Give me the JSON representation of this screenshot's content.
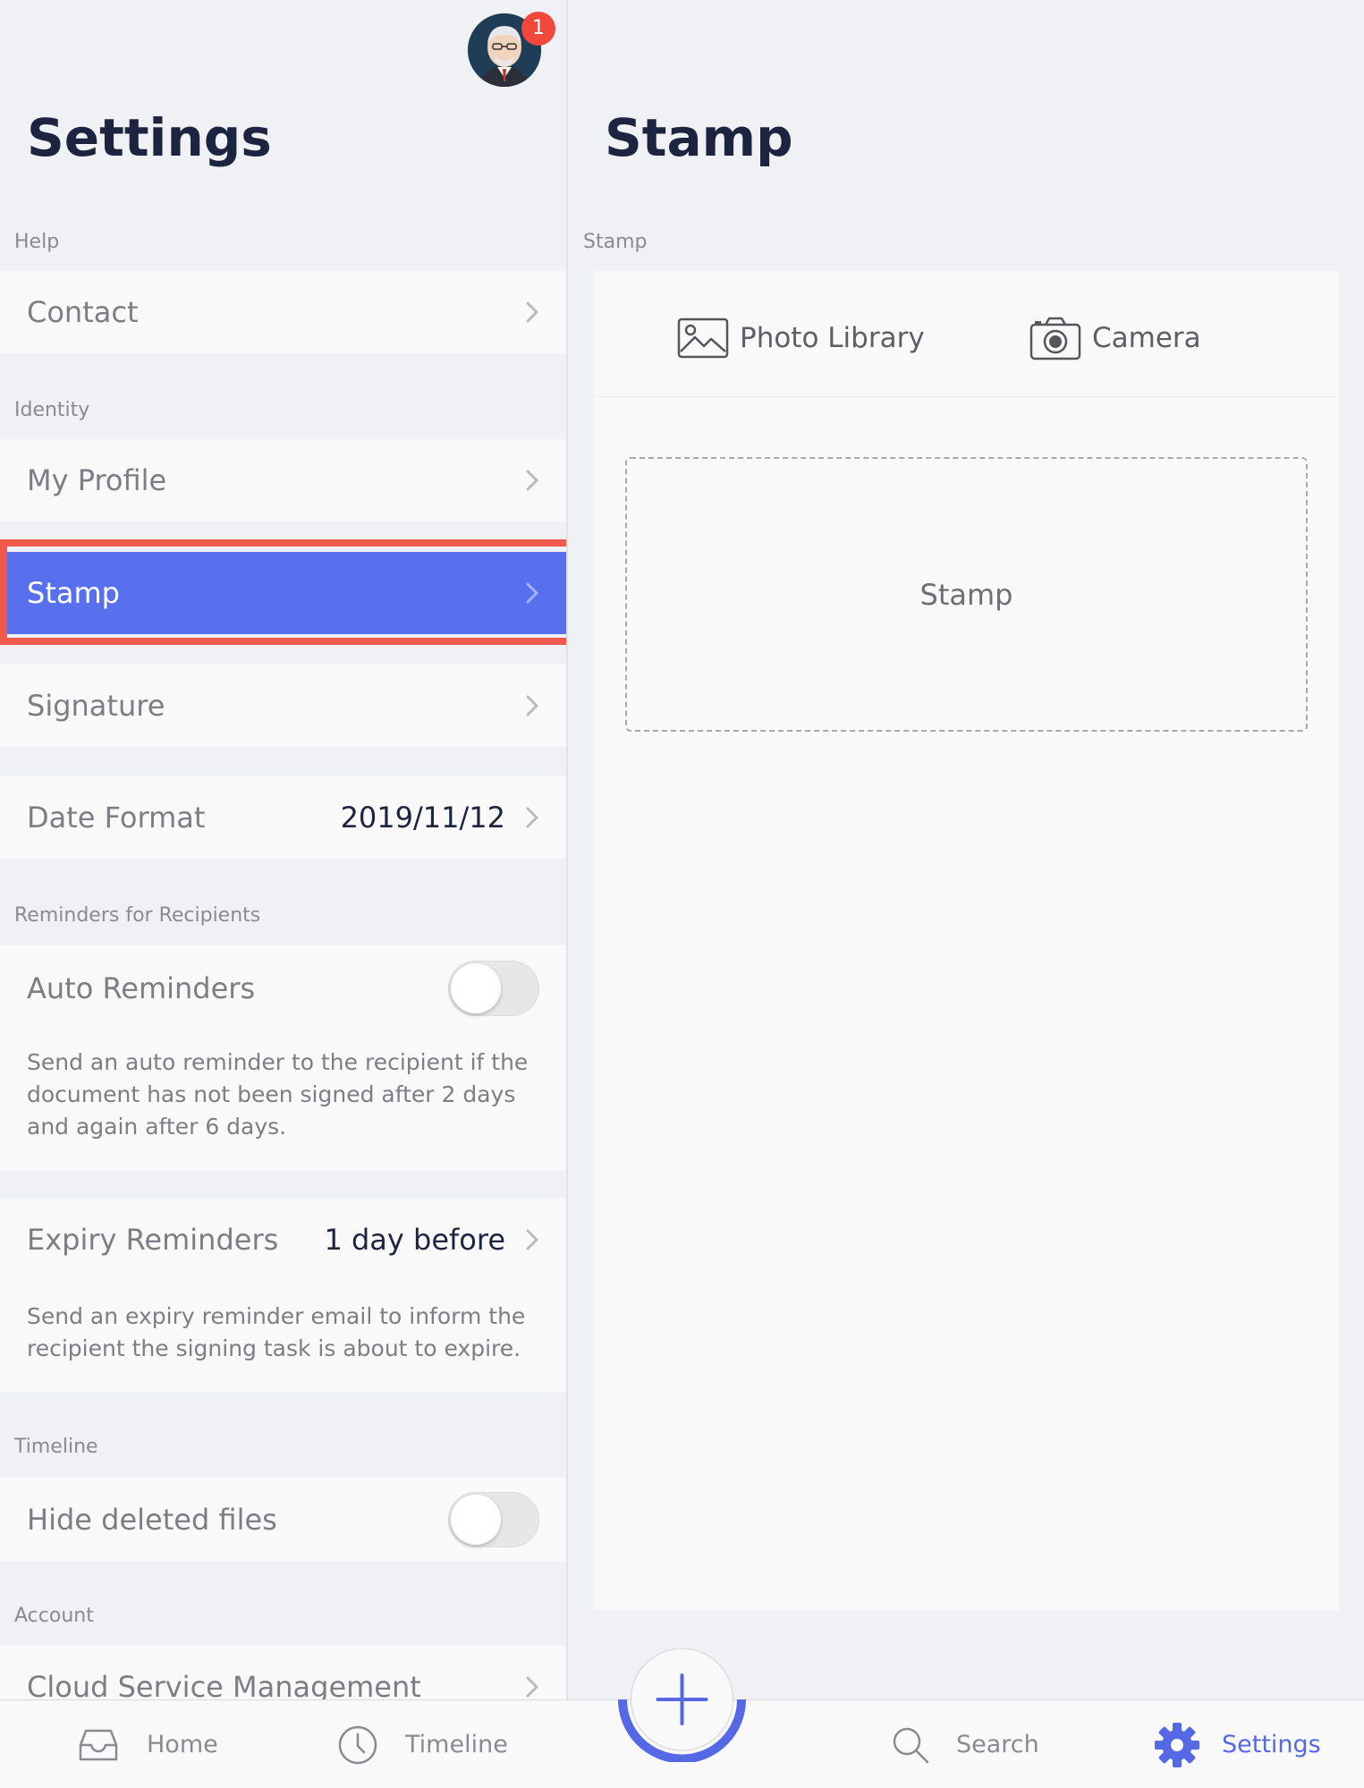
{
  "left": {
    "title": "Settings",
    "notification_count": "1",
    "sections": {
      "help": "Help",
      "identity": "Identity",
      "reminders": "Reminders for Recipients",
      "timeline": "Timeline",
      "account": "Account"
    },
    "rows": {
      "contact": "Contact",
      "my_profile": "My Profile",
      "stamp": "Stamp",
      "signature": "Signature",
      "date_format": "Date Format",
      "date_format_value": "2019/11/12",
      "auto_reminders": "Auto Reminders",
      "auto_reminders_desc": "Send an auto reminder to the recipient if the document has not been signed after 2 days and again after 6 days.",
      "expiry_reminders": "Expiry Reminders",
      "expiry_reminders_value": "1 day before",
      "expiry_reminders_desc": "Send an expiry reminder email to inform the recipient the signing task is about to expire.",
      "hide_deleted": "Hide deleted files",
      "cloud_service": "Cloud Service Management"
    },
    "toggles": {
      "auto_reminders": false,
      "hide_deleted": false
    }
  },
  "right": {
    "title": "Stamp",
    "section_label": "Stamp",
    "photo_library": "Photo Library",
    "camera": "Camera",
    "placeholder": "Stamp"
  },
  "tabbar": {
    "home": "Home",
    "timeline": "Timeline",
    "search": "Search",
    "settings": "Settings",
    "active": "settings"
  },
  "colors": {
    "accent": "#5970ee",
    "highlight_outline": "#ef5a4c",
    "title": "#1d2440",
    "badge": "#f2473c",
    "active_tab": "#5568e6"
  },
  "icons": [
    "avatar",
    "chevron-right-icon",
    "photo-library-icon",
    "camera-icon",
    "home-inbox-icon",
    "clock-icon",
    "plus-icon",
    "search-icon",
    "gear-icon"
  ]
}
